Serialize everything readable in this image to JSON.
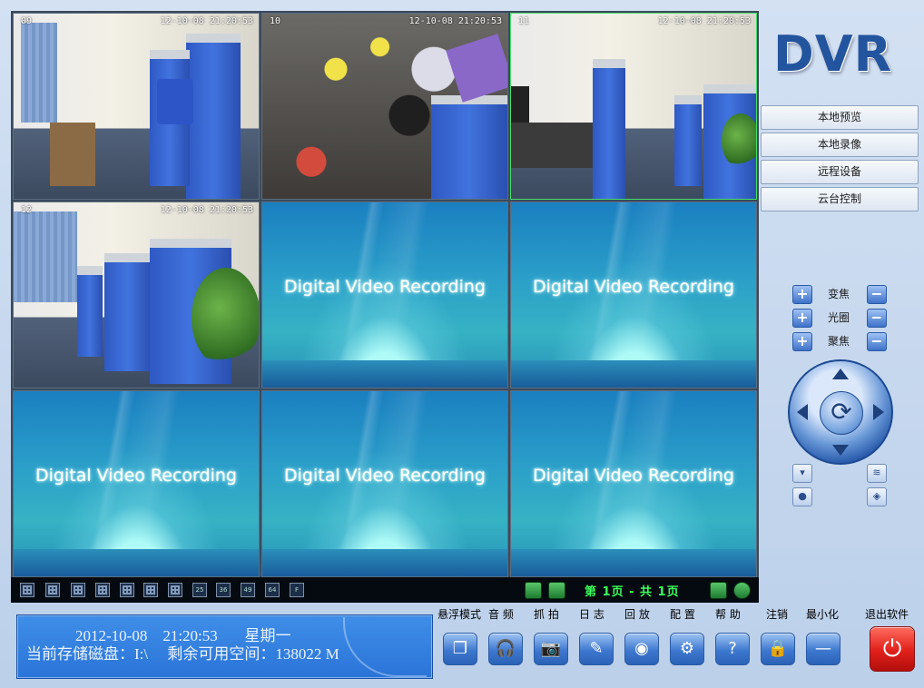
{
  "app": {
    "logo": "DVR"
  },
  "tiles": [
    {
      "id": "09",
      "timestamp": "12-10-08 21:20:53",
      "kind": "camera"
    },
    {
      "id": "10",
      "timestamp": "12-10-08 21:20:53",
      "kind": "camera"
    },
    {
      "id": "11",
      "timestamp": "12-10-08 21:20:53",
      "kind": "camera",
      "selected": true
    },
    {
      "id": "12",
      "timestamp": "12-10-08 21:20:53",
      "kind": "camera"
    },
    {
      "kind": "placeholder",
      "caption": "Digital Video Recording"
    },
    {
      "kind": "placeholder",
      "caption": "Digital Video Recording"
    },
    {
      "kind": "placeholder",
      "caption": "Digital Video Recording"
    },
    {
      "kind": "placeholder",
      "caption": "Digital Video Recording"
    },
    {
      "kind": "placeholder",
      "caption": "Digital Video Recording"
    }
  ],
  "grid_toolbar": {
    "layout_buttons": [
      "",
      "",
      "",
      "",
      "",
      "",
      "",
      "25",
      "36",
      "49",
      "64",
      "F"
    ],
    "page_info": "第 1页 - 共 1页"
  },
  "nav": [
    "本地预览",
    "本地录像",
    "远程设备",
    "云台控制"
  ],
  "ptz": {
    "zoom_label": "变焦",
    "iris_label": "光圈",
    "focus_label": "聚焦",
    "plus": "+",
    "minus": "−",
    "center_icon": "⟳"
  },
  "status": {
    "datetime": "2012-10-08    21:20:53       星期一",
    "storage": "当前存储磁盘：I:\\     剩余可用空间：138022 M"
  },
  "toolbar": [
    {
      "label": "悬浮模式",
      "icon": "windows-icon",
      "glyph": "❐"
    },
    {
      "label": "音  频",
      "icon": "headphones-icon",
      "glyph": "🎧"
    },
    {
      "label": "抓  拍",
      "icon": "camera-icon",
      "glyph": "📷"
    },
    {
      "label": "日  志",
      "icon": "pencil-icon",
      "glyph": "✎"
    },
    {
      "label": "回  放",
      "icon": "film-reel-icon",
      "glyph": "◉"
    },
    {
      "label": "配  置",
      "icon": "gears-icon",
      "glyph": "⚙"
    },
    {
      "label": "帮  助",
      "icon": "help-icon",
      "glyph": "?"
    },
    {
      "label": "注销",
      "icon": "lock-icon",
      "glyph": "🔒"
    },
    {
      "label": "最小化",
      "icon": "minimize-icon",
      "glyph": "—"
    }
  ],
  "exit": {
    "label": "退出软件",
    "glyph": "⏻"
  },
  "colors": {
    "accent": "#2a74d8",
    "page_text": "#3bff5a",
    "exit": "#e0201a"
  }
}
